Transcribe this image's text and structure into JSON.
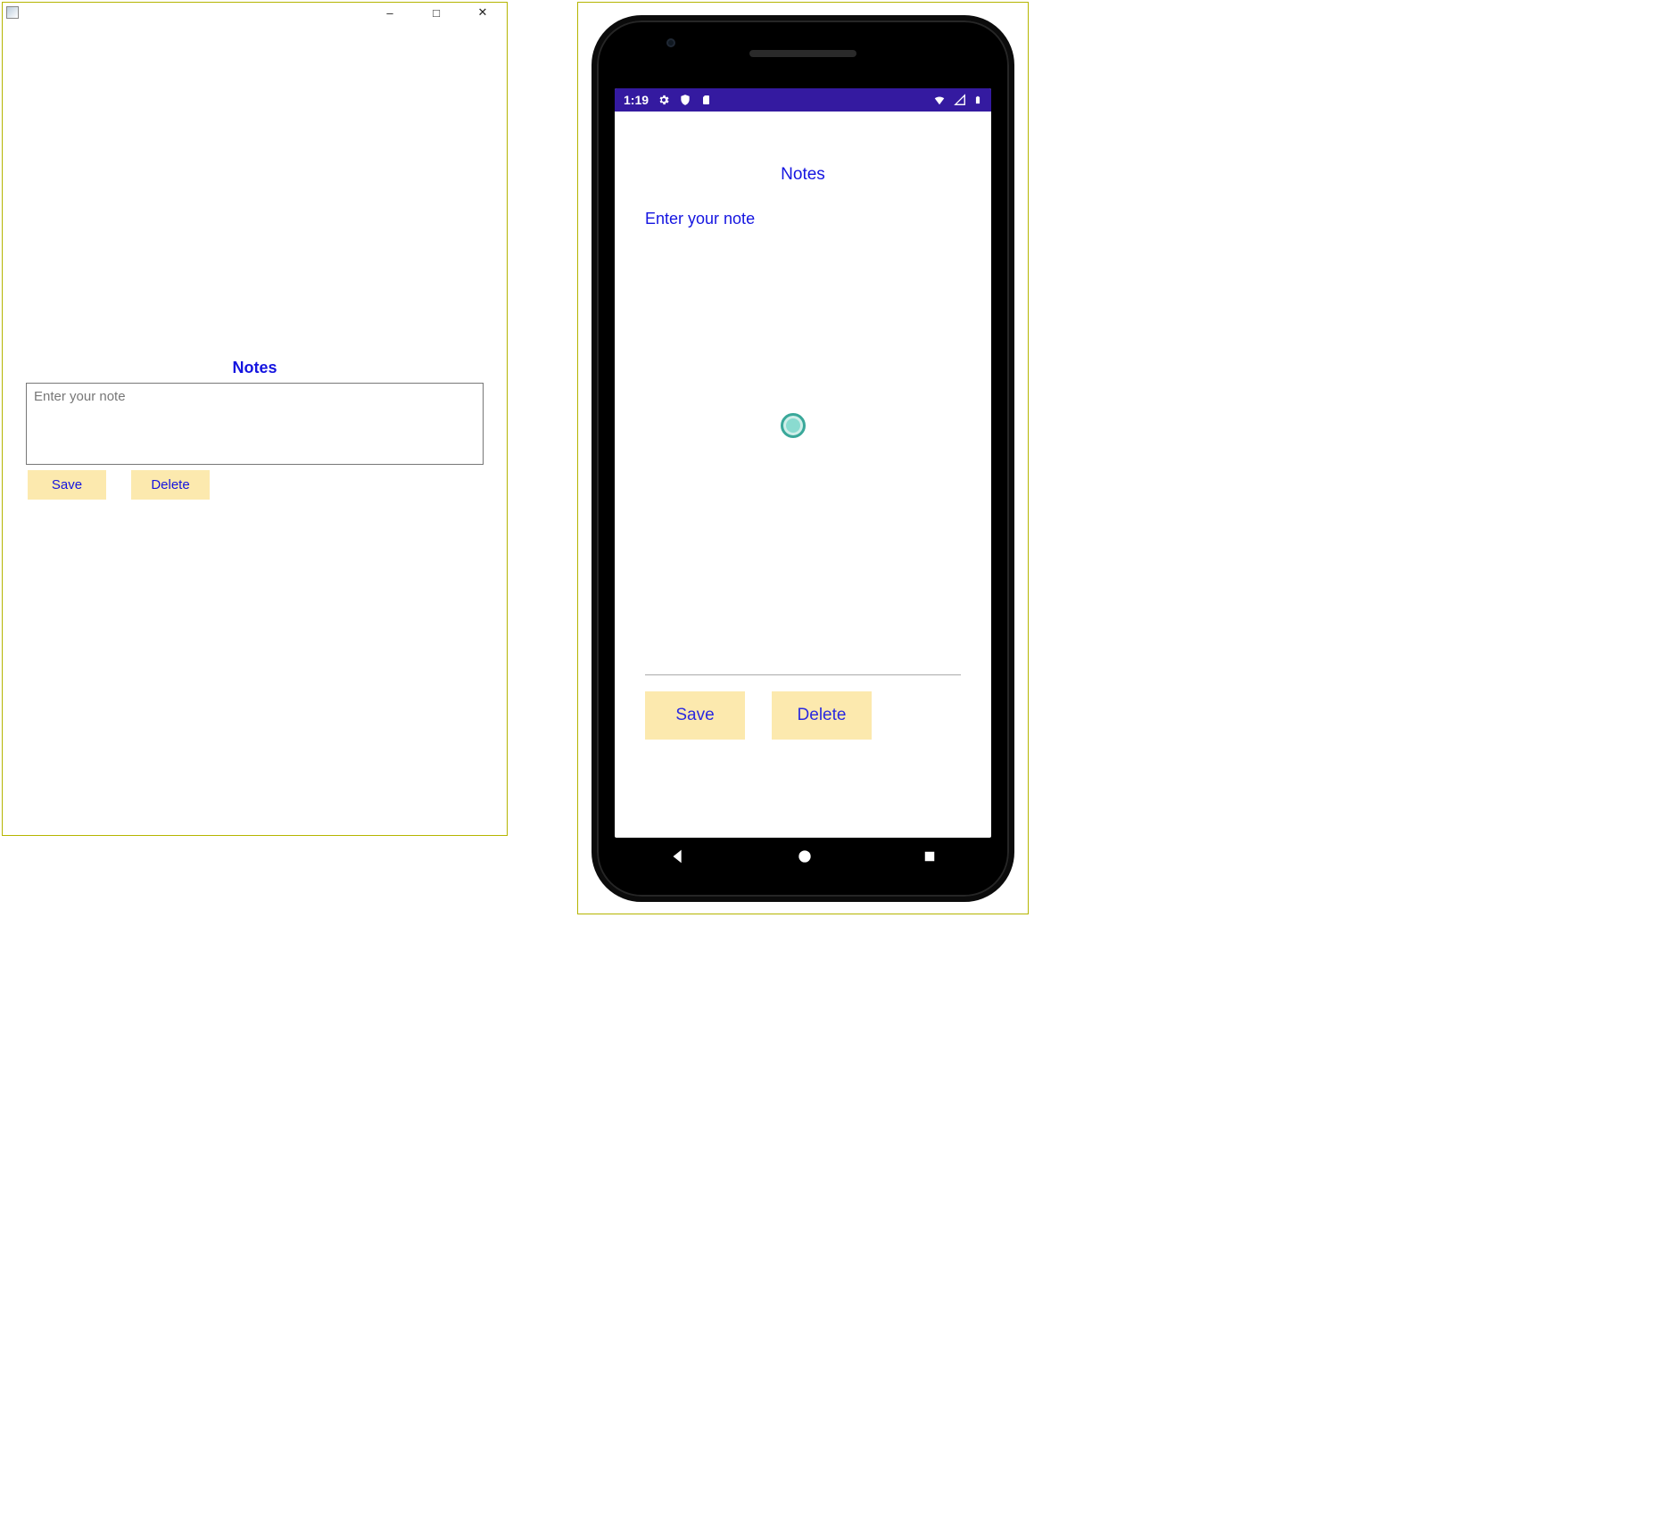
{
  "desktop": {
    "title_icon": "app-icon",
    "minimize_glyph": "–",
    "maximize_glyph": "□",
    "close_glyph": "✕",
    "notes_label": "Notes",
    "note_placeholder": "Enter your note",
    "save_label": "Save",
    "delete_label": "Delete"
  },
  "mobile": {
    "status": {
      "time": "1:19",
      "gear_icon": "gear-icon",
      "shield_icon": "shield-icon",
      "sd_icon": "sd-icon",
      "wifi_icon": "wifi-icon",
      "signal_icon": "signal-icon",
      "battery_icon": "battery-icon"
    },
    "app_bar_color": "#341aa0",
    "notes_label": "Notes",
    "note_placeholder": "Enter your note",
    "save_label": "Save",
    "delete_label": "Delete",
    "nav": {
      "back_icon": "back-icon",
      "home_icon": "home-icon",
      "recent_icon": "recent-icon"
    }
  },
  "colors": {
    "accent_text": "#1414e0",
    "button_bg": "#fce9ae",
    "frame_border": "#b5b500"
  }
}
